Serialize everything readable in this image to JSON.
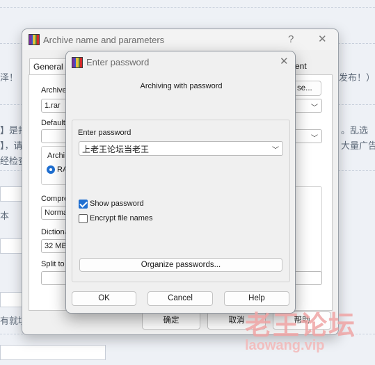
{
  "background_page": {
    "fragments": [
      "泽！",
      "发布！）",
      "】是打",
      "。乱选",
      "】，请",
      "大量广告",
      "经检查",
      "本",
      "有就填"
    ]
  },
  "archive_dialog": {
    "title": "Archive name and parameters",
    "help_glyph": "?",
    "close_glyph": "✕",
    "tabs": {
      "general": "General",
      "comment_partial": "ent"
    },
    "archive_label": "Archive",
    "archive_name": "1.rar",
    "browse_partial": "se...",
    "default_label": "Default",
    "archive_format_label": "Archi",
    "radio_rar": "RA",
    "compression_label": "Compre",
    "compression_value": "Normal",
    "dictionary_label": "Dictiona",
    "dictionary_value": "32 MB",
    "split_label": "Split to",
    "ok_button": "确定",
    "cancel_button": "取消",
    "help_button": "帮助"
  },
  "password_dialog": {
    "title": "Enter password",
    "close_glyph": "✕",
    "subtitle": "Archiving with password",
    "enter_password_label": "Enter password",
    "password_value": "上老王论坛当老王",
    "show_password_label": "Show password",
    "show_password_checked": true,
    "encrypt_names_label": "Encrypt file names",
    "encrypt_names_checked": false,
    "organize_button": "Organize passwords...",
    "ok_button": "OK",
    "cancel_button": "Cancel",
    "help_button": "Help"
  },
  "watermark": {
    "cn": "老王论坛",
    "en": "laowang.vip"
  }
}
